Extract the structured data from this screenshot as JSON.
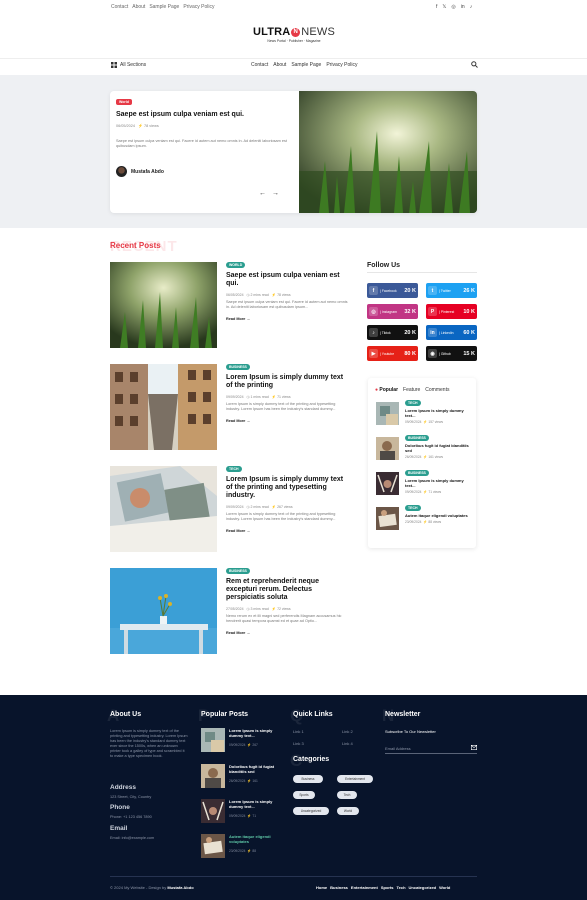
{
  "topbar": {
    "links": [
      "Contact",
      "About",
      "Sample Page",
      "Privacy Policy"
    ],
    "social_icons": [
      "facebook-icon",
      "x-icon",
      "instagram-icon",
      "linkedin-icon",
      "tiktok-icon"
    ]
  },
  "logo": {
    "word1": "ULTRA",
    "badge": "N",
    "word2": "NEWS",
    "tagline": "News Portal  ·  Publisher  ·  Magazine"
  },
  "nav": {
    "all_sections": "All Sections",
    "links": [
      "Contact",
      "About",
      "Sample Page",
      "Privacy Policy"
    ]
  },
  "hero": {
    "tag": "World",
    "title": "Saepe est ipsum culpa veniam est qui.",
    "date": "06/05/2024",
    "views": "78 views",
    "excerpt": "Saepe est ipsum culpa veniam est qui. Facere id autem aut nemo omnis in. Ad deleniti laboriosam est quibusdam ipsum.",
    "author": "Mustafa Abdo",
    "prev": "←",
    "next": "→"
  },
  "recent": {
    "title": "Recent Posts",
    "ghost": "RECENT",
    "posts": [
      {
        "tag": "WORLD",
        "title": "Saepe est ipsum culpa veniam est qui.",
        "date": "06/05/2024",
        "read": "2 mins read",
        "views": "78 views",
        "excerpt": "Saepe est ipsum culpa veniam est qui. Facere id autem aut nemo omnis in. Ad deleniti laboriosam est quibusdam ipsum...",
        "more": "Read More"
      },
      {
        "tag": "BUSINESS",
        "title": "Lorem Ipsum is simply dummy text of the printing",
        "date": "09/09/2024",
        "read": "1 mins read",
        "views": "71 views",
        "excerpt": "Lorem Ipsum is simply dummy text of the printing and typesetting industry. Lorem Ipsum has been the industry's standard dummy...",
        "more": "Read More"
      },
      {
        "tag": "TECH",
        "title": "Lorem Ipsum is simply dummy text of the printing and typesetting industry.",
        "date": "09/09/2024",
        "read": "2 mins read",
        "views": "267 views",
        "excerpt": "Lorem Ipsum is simply dummy text of the printing and typesetting industry. Lorem Ipsum has been the industry's standard dummy...",
        "more": "Read More"
      },
      {
        "tag": "BUSINESS",
        "title": "Rem et reprehenderit neque excepturi rerum. Delectus perspiciatis soluta",
        "date": "27/05/2024",
        "read": "3 mins read",
        "views": "72 views",
        "excerpt": "Nemo rerum ex et illi magni sed perferendis Magnam accusamus hic hendrerit quasi tempora quamst ed et quae ad Optio...",
        "more": "Read More"
      }
    ]
  },
  "follow": {
    "title": "Follow Us",
    "items": [
      {
        "label": "| Facebook",
        "count": "20 K",
        "icon": "f",
        "color": "#3b5998"
      },
      {
        "label": "| Twitter",
        "count": "26 K",
        "icon": "t",
        "color": "#1da1f2"
      },
      {
        "label": "| Instagram",
        "count": "32 K",
        "icon": "◎",
        "color": "#c13584"
      },
      {
        "label": "| Pinterest",
        "count": "10 K",
        "icon": "P",
        "color": "#e60023"
      },
      {
        "label": "| Tiktok",
        "count": "20 K",
        "icon": "♪",
        "color": "#111111"
      },
      {
        "label": "| Linkedin",
        "count": "60 K",
        "icon": "in",
        "color": "#0a66c2"
      },
      {
        "label": "| Youtube",
        "count": "80 K",
        "icon": "▶",
        "color": "#e62117"
      },
      {
        "label": "| Github",
        "count": "15 K",
        "icon": "◉",
        "color": "#111111"
      }
    ]
  },
  "popular": {
    "tabs": [
      "Popular",
      "Feature",
      "Comments"
    ],
    "items": [
      {
        "tag": "TECH",
        "title": "Lorem Ipsum is simply dummy text...",
        "date": "09/09/2024",
        "views": "157 views"
      },
      {
        "tag": "BUSINESS",
        "title": "Doloribus fugit id fugiat blanditiis sed",
        "date": "26/09/2024",
        "views": "161 views"
      },
      {
        "tag": "BUSINESS",
        "title": "Lorem Ipsum is simply dummy text...",
        "date": "09/09/2024",
        "views": "71 views"
      },
      {
        "tag": "TECH",
        "title": "Autem itaque eligendi voluptates",
        "date": "23/09/2024",
        "views": "88 views"
      }
    ]
  },
  "footer": {
    "about": {
      "title": "About Us",
      "ghost": "A",
      "text": "Lorem Ipsum is simply dummy text of the printing and typesetting industry. Lorem Ipsum has been the industry's standard dummy text ever since the 1500s, when an unknown printer took a galley of type and scrambled it to make a type specimen book.",
      "address_h": "Address",
      "address": "123 Street, City, Country",
      "phone_h": "Phone",
      "phone": "Phone: +1 123 456 7890",
      "email_h": "Email",
      "email": "Email: info@example.com"
    },
    "popular": {
      "title": "Popular Posts",
      "ghost": "P",
      "items": [
        {
          "title": "Lorem Ipsum is simply dummy text...",
          "date": "09/09/2024",
          "views": "267"
        },
        {
          "title": "Doloribus fugit id fugiat blanditiis sed",
          "date": "26/09/2024",
          "views": "161"
        },
        {
          "title": "Lorem Ipsum is simply dummy text...",
          "date": "09/09/2024",
          "views": "71"
        },
        {
          "title": "Autem itaque eligendi voluptates",
          "date": "23/09/2024",
          "views": "88"
        }
      ]
    },
    "quick": {
      "title": "Quick Links",
      "ghost": "Q",
      "links": [
        "Link 1",
        "Link 2",
        "Link 3",
        "Link 4"
      ]
    },
    "categories": {
      "title": "Categories",
      "ghost": "C",
      "chips": [
        "Business",
        "Entertainment",
        "Sports",
        "Tech",
        "Uncategorized",
        "World"
      ]
    },
    "newsletter": {
      "title": "Newsletter",
      "ghost": "N",
      "subtitle": "Subscribe To Our Newsletter",
      "placeholder": "Email Address"
    },
    "copyright_pre": "© 2024 My Website - Design by ",
    "copyright_name": "Mustafa Abdo",
    "bottom_links": [
      "Home",
      "Business",
      "Entertainment",
      "Sports",
      "Tech",
      "Uncategorized",
      "World"
    ]
  }
}
